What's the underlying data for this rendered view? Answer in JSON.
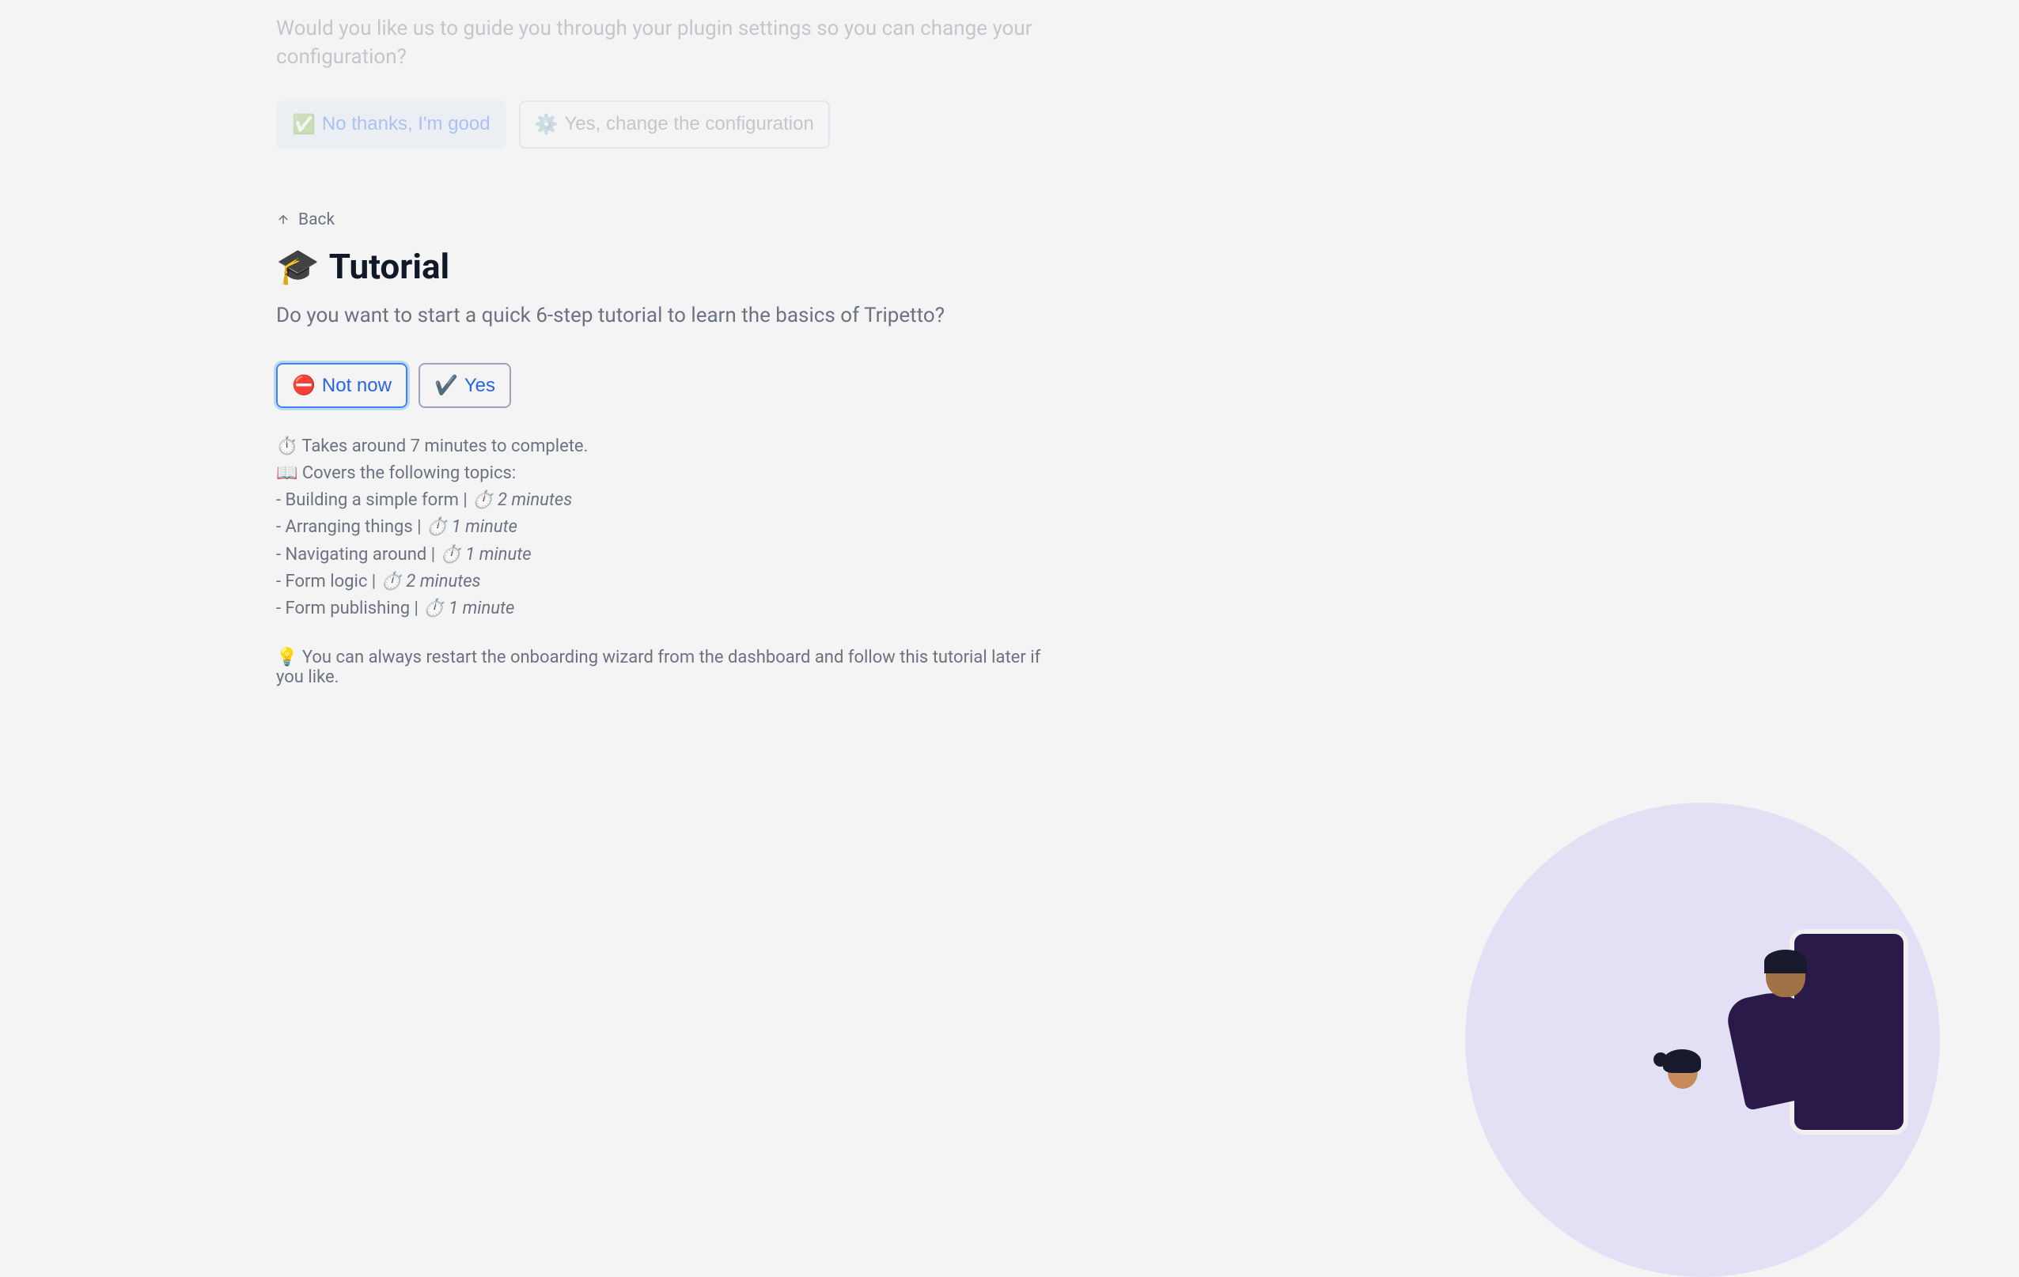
{
  "faded": {
    "subtitle": "Would you like us to guide you through your plugin settings so you can change your configuration?",
    "primary_button_emoji": "✅",
    "primary_button_label": "No thanks, I'm good",
    "outline_button_emoji": "⚙️",
    "outline_button_label": "Yes, change the configuration"
  },
  "back": {
    "label": "Back"
  },
  "title": {
    "emoji": "🎓",
    "text": "Tutorial"
  },
  "subtitle": "Do you want to start a quick 6-step tutorial to learn the basics of Tripetto?",
  "actions": {
    "not_now_emoji": "⛔",
    "not_now_label": "Not now",
    "yes_emoji": "✔️",
    "yes_label": "Yes"
  },
  "details": {
    "duration_line": "⏱️ Takes around 7 minutes to complete.",
    "topics_intro": "📖 Covers the following topics:",
    "topics": [
      {
        "prefix": "- Building a simple form | ",
        "duration": "⏱️ 2 minutes"
      },
      {
        "prefix": "- Arranging things | ",
        "duration": "⏱️ 1 minute"
      },
      {
        "prefix": "- Navigating around | ",
        "duration": "⏱️ 1 minute"
      },
      {
        "prefix": "- Form logic | ",
        "duration": "⏱️ 2 minutes"
      },
      {
        "prefix": "- Form publishing | ",
        "duration": "⏱️ 1 minute"
      }
    ]
  },
  "tip": "💡 You can always restart the onboarding wizard from the dashboard and follow this tutorial later if you like."
}
